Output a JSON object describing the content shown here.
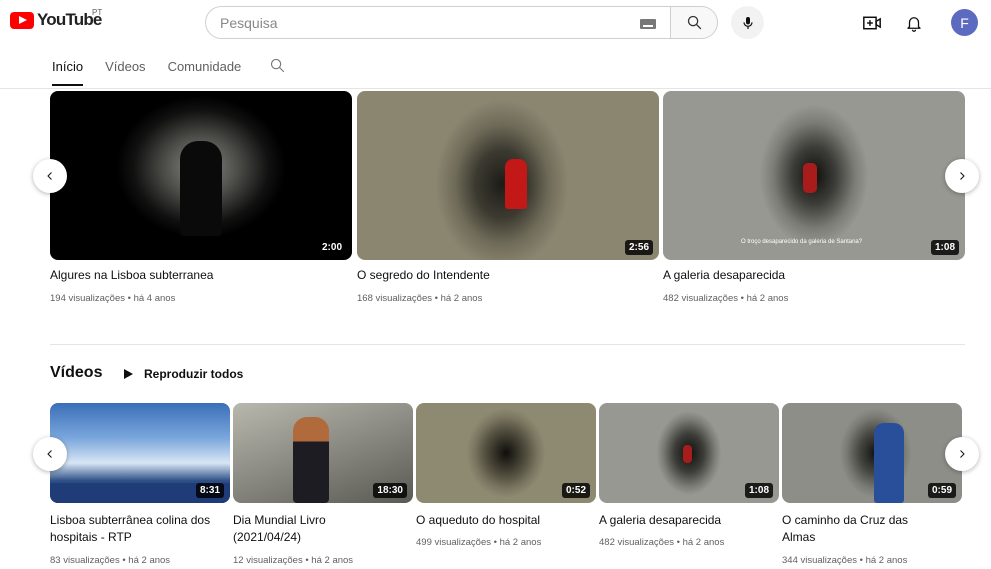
{
  "header": {
    "logo_text": "YouTube",
    "country_code": "PT",
    "search_placeholder": "Pesquisa",
    "avatar_letter": "F"
  },
  "tabs": [
    {
      "label": "Início",
      "active": true
    },
    {
      "label": "Vídeos",
      "active": false
    },
    {
      "label": "Comunidade",
      "active": false
    }
  ],
  "shelf1": {
    "items": [
      {
        "title": "Algures na Lisboa subterranea",
        "meta": "194 visualizações • há 4 anos",
        "duration": "2:00"
      },
      {
        "title": "O segredo do Intendente",
        "meta": "168 visualizações • há 2 anos",
        "duration": "2:56"
      },
      {
        "title": "A galeria desaparecida",
        "meta": "482 visualizações • há 2 anos",
        "duration": "1:08",
        "caption": "O troço desaparecido da galeria de Santana?"
      }
    ]
  },
  "shelf2": {
    "title": "Vídeos",
    "play_all": "Reproduzir todos",
    "items": [
      {
        "title": "Lisboa subterrânea colina dos hospitais - RTP",
        "meta": "83 visualizações • há 2 anos",
        "duration": "8:31"
      },
      {
        "title": "Dia Mundial Livro (2021/04/24)",
        "meta": "12 visualizações • há 2 anos",
        "duration": "18:30"
      },
      {
        "title": "O aqueduto do hospital",
        "meta": "499 visualizações • há 2 anos",
        "duration": "0:52"
      },
      {
        "title": "A galeria desaparecida",
        "meta": "482 visualizações • há 2 anos",
        "duration": "1:08"
      },
      {
        "title": "O caminho da Cruz das Almas",
        "meta": "344 visualizações • há 2 anos",
        "duration": "0:59"
      }
    ]
  },
  "colors": {
    "brand_red": "#ff0000",
    "avatar": "#5c6bc0",
    "text_primary": "#0f0f0f",
    "text_secondary": "#606060"
  }
}
